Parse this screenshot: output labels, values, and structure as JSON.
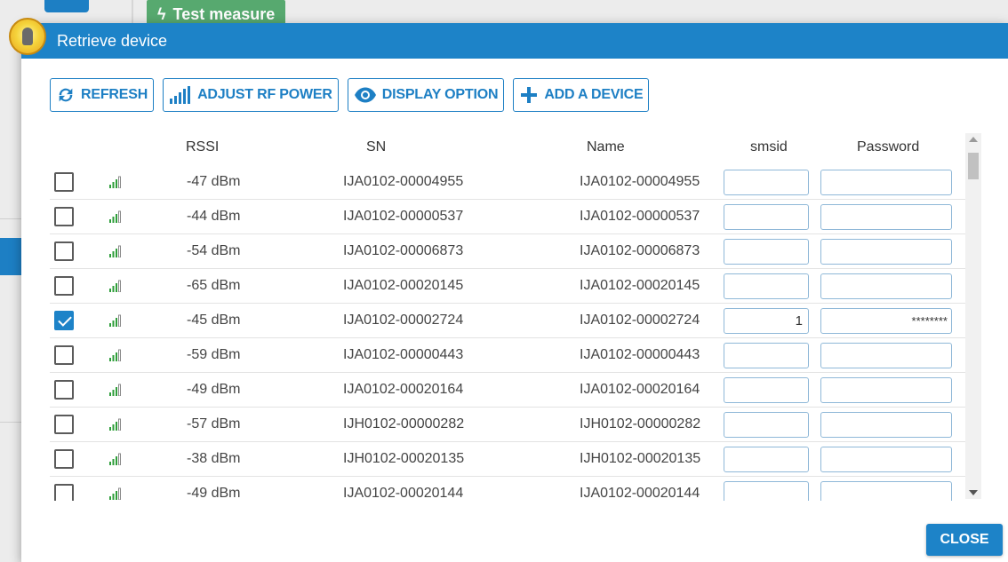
{
  "background": {
    "test_button_label": "Test measure"
  },
  "dialog": {
    "title": "Retrieve device"
  },
  "toolbar": {
    "refresh_label": "REFRESH",
    "adjust_rf_power_label": "ADJUST RF POWER",
    "display_option_label": "DISPLAY OPTION",
    "add_device_label": "ADD A DEVICE"
  },
  "table": {
    "columns": [
      "",
      "",
      "RSSI",
      "SN",
      "Name",
      "smsid",
      "Password"
    ],
    "rows": [
      {
        "checked": false,
        "rssi": "-47 dBm",
        "sn": "IJA0102-00004955",
        "name": "IJA0102-00004955",
        "smsid": "",
        "password": ""
      },
      {
        "checked": false,
        "rssi": "-44 dBm",
        "sn": "IJA0102-00000537",
        "name": "IJA0102-00000537",
        "smsid": "",
        "password": ""
      },
      {
        "checked": false,
        "rssi": "-54 dBm",
        "sn": "IJA0102-00006873",
        "name": "IJA0102-00006873",
        "smsid": "",
        "password": ""
      },
      {
        "checked": false,
        "rssi": "-65 dBm",
        "sn": "IJA0102-00020145",
        "name": "IJA0102-00020145",
        "smsid": "",
        "password": ""
      },
      {
        "checked": true,
        "rssi": "-45 dBm",
        "sn": "IJA0102-00002724",
        "name": "IJA0102-00002724",
        "smsid": "1",
        "password": "********"
      },
      {
        "checked": false,
        "rssi": "-59 dBm",
        "sn": "IJA0102-00000443",
        "name": "IJA0102-00000443",
        "smsid": "",
        "password": ""
      },
      {
        "checked": false,
        "rssi": "-49 dBm",
        "sn": "IJA0102-00020164",
        "name": "IJA0102-00020164",
        "smsid": "",
        "password": ""
      },
      {
        "checked": false,
        "rssi": "-57 dBm",
        "sn": "IJH0102-00000282",
        "name": "IJH0102-00000282",
        "smsid": "",
        "password": ""
      },
      {
        "checked": false,
        "rssi": "-38 dBm",
        "sn": "IJH0102-00020135",
        "name": "IJH0102-00020135",
        "smsid": "",
        "password": ""
      },
      {
        "checked": false,
        "rssi": "-49 dBm",
        "sn": "IJA0102-00020144",
        "name": "IJA0102-00020144",
        "smsid": "",
        "password": ""
      }
    ]
  },
  "footer": {
    "close_label": "CLOSE"
  },
  "colors": {
    "accent": "#1d83c8",
    "signal": "#2e9e3a"
  }
}
